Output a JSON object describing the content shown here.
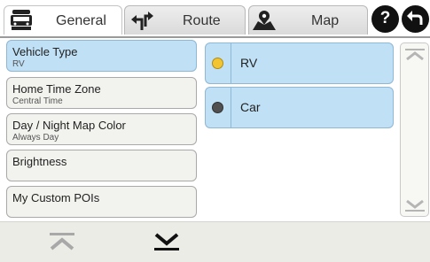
{
  "tabs": [
    {
      "label": "General",
      "icon": "truck-icon"
    },
    {
      "label": "Route",
      "icon": "turn-arrows-icon"
    },
    {
      "label": "Map",
      "icon": "map-pin-icon"
    }
  ],
  "header_buttons": {
    "help": "?",
    "back_icon": "back-arrow-icon"
  },
  "settings": [
    {
      "title": "Vehicle Type",
      "subtitle": "RV",
      "selected": true
    },
    {
      "title": "Home Time Zone",
      "subtitle": "Central Time",
      "selected": false
    },
    {
      "title": "Day / Night Map Color",
      "subtitle": "Always Day",
      "selected": false
    },
    {
      "title": "Brightness",
      "subtitle": "",
      "selected": false
    },
    {
      "title": "My Custom POIs",
      "subtitle": "",
      "selected": false
    }
  ],
  "options": [
    {
      "label": "RV",
      "color": "#f2c530",
      "active": true
    },
    {
      "label": "Car",
      "color": "#505050",
      "active": false
    }
  ],
  "colors": {
    "selected_bg": "#bfe0f5",
    "accent": "#8fb7d6"
  }
}
